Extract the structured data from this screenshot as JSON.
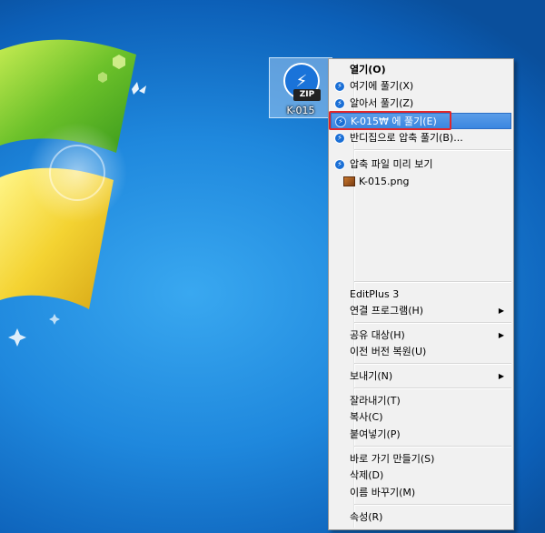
{
  "desktop_icon": {
    "label": "K-015",
    "badge_text": "ZIP"
  },
  "context_menu": {
    "items": [
      {
        "id": "open",
        "label": "열기(O)"
      },
      {
        "id": "extract-here",
        "label": "여기에 풀기(X)"
      },
      {
        "id": "extract-smart",
        "label": "알아서 풀기(Z)"
      },
      {
        "id": "extract-to-folder",
        "label": "K-015₩ 에 풀기(E)"
      },
      {
        "id": "extract-bandizip",
        "label": "반디집으로 압축 풀기(B)..."
      },
      {
        "id": "preview",
        "label": "압축 파일 미리 보기"
      },
      {
        "id": "preview-file",
        "label": "K-015.png"
      },
      {
        "id": "editplus",
        "label": "EditPlus 3"
      },
      {
        "id": "open-with",
        "label": "연결 프로그램(H)"
      },
      {
        "id": "share-with",
        "label": "공유 대상(H)"
      },
      {
        "id": "restore-previous",
        "label": "이전 버전 복원(U)"
      },
      {
        "id": "send-to",
        "label": "보내기(N)"
      },
      {
        "id": "cut",
        "label": "잘라내기(T)"
      },
      {
        "id": "copy",
        "label": "복사(C)"
      },
      {
        "id": "paste",
        "label": "붙여넣기(P)"
      },
      {
        "id": "create-shortcut",
        "label": "바로 가기 만들기(S)"
      },
      {
        "id": "delete",
        "label": "삭제(D)"
      },
      {
        "id": "rename",
        "label": "이름 바꾸기(M)"
      },
      {
        "id": "properties",
        "label": "속성(R)"
      }
    ],
    "highlighted": "extract-to-folder"
  },
  "colors": {
    "highlight": "#3b86e0",
    "annotation": "#e1262a",
    "desktop": "#1f88dd"
  }
}
